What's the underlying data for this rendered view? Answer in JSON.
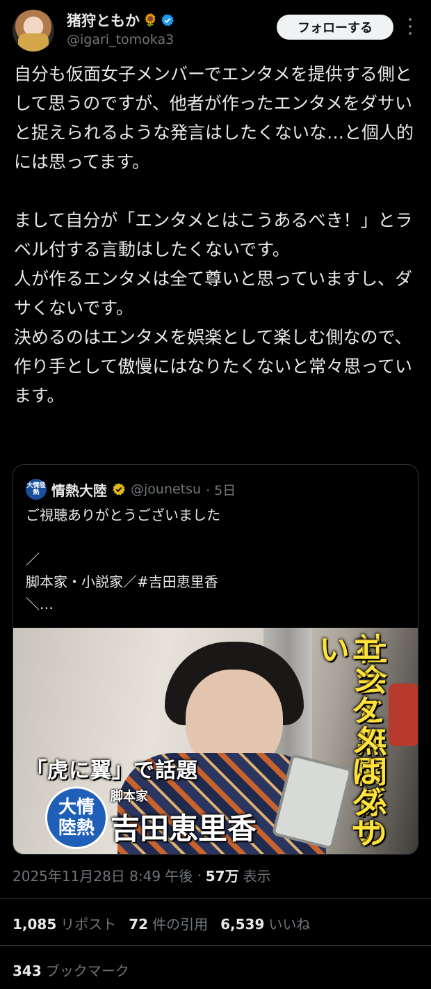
{
  "author": {
    "display_name": "猪狩ともか",
    "handle": "@igari_tomoka3",
    "emoji": "🌻",
    "follow_label": "フォローする"
  },
  "tweet": {
    "text": "自分も仮面女子メンバーでエンタメを提供する側として思うのですが、他者が作ったエンタメをダサいと捉えられるような発言はしたくないな…と個人的には思ってます。\n\nまして自分が「エンタメとはこうあるべき！」とラベル付する言動はしたくないです。\n人が作るエンタメは全て尊いと思っていますし、ダサくないです。\n決めるのはエンタメを娯楽として楽しむ側なので、作り手として傲慢にはなりたくないと常々思っています。"
  },
  "quote": {
    "logo_text": "大情陸熱",
    "name": "情熱大陸",
    "handle": "@jounetsu",
    "time": "· 5日",
    "text": "ご視聴ありがとうございました\n\n／\n脚本家・小説家／#吉田恵里香\n＼…",
    "image": {
      "headline": "「虎に翼」で話題",
      "logo": "大情\n陸熱",
      "role": "脚本家",
      "person": "吉田恵里香",
      "vertical_1": "社会と無関係の",
      "vertical_2": "エンタメはダサい"
    }
  },
  "meta": {
    "timestamp": "2025年11月28日 8:49 午後",
    "separator": "·",
    "views_count": "57万",
    "views_label": "表示"
  },
  "stats": {
    "reposts_count": "1,085",
    "reposts_label": "リポスト",
    "quotes_count": "72",
    "quotes_label": "件の引用",
    "likes_count": "6,539",
    "likes_label": "いいね",
    "bookmarks_count": "343",
    "bookmarks_label": "ブックマーク"
  },
  "colors": {
    "background": "#000000",
    "text": "#e7e9ea",
    "muted": "#71767b",
    "verified_blue": "#1d9bf0",
    "affiliate_gold": "#e2b719"
  }
}
